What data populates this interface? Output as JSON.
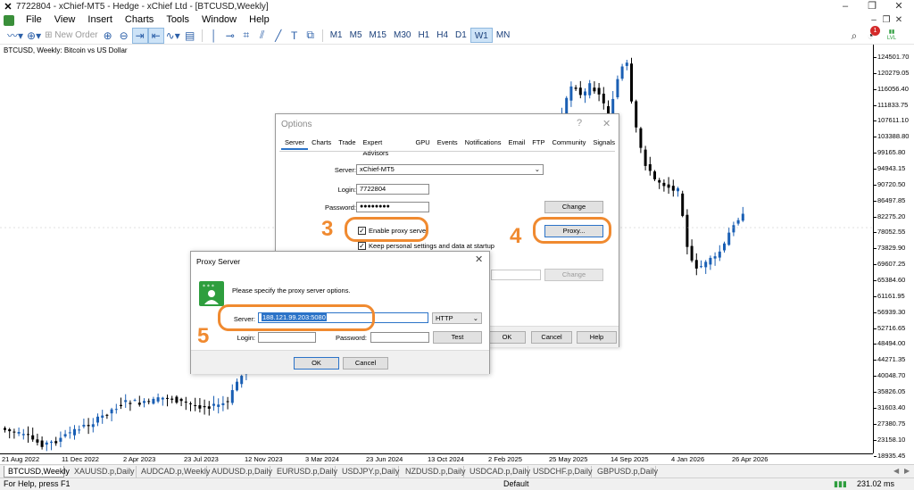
{
  "window": {
    "title": "7722804 - xChief-MT5 - Hedge - xChief Ltd - [BTCUSD,Weekly]",
    "controls": [
      "–",
      "❐",
      "✕"
    ]
  },
  "menu": [
    "File",
    "View",
    "Insert",
    "Charts",
    "Tools",
    "Window",
    "Help"
  ],
  "toolbar": {
    "new_order": "New Order",
    "timeframes": [
      "M1",
      "M5",
      "M15",
      "M30",
      "H1",
      "H4",
      "D1",
      "W1",
      "MN"
    ],
    "active_timeframe": "W1",
    "notification_count": "1",
    "lvl_label": "LVL"
  },
  "chart": {
    "symbol_label": "BTCUSD, Weekly:  Bitcoin vs US Dollar",
    "price_labels": [
      "124501.70",
      "120279.05",
      "116056.40",
      "111833.75",
      "107611.10",
      "103388.80",
      "99165.80",
      "94943.15",
      "90720.50",
      "86497.85",
      "82275.20",
      "78052.55",
      "73829.90",
      "69607.25",
      "65384.60",
      "61161.95",
      "56939.30",
      "52716.65",
      "48494.00",
      "44271.35",
      "40048.70",
      "35826.05",
      "31603.40",
      "27380.75",
      "23158.10",
      "18935.45"
    ],
    "date_labels": [
      "21 Aug 2022",
      "11 Dec 2022",
      "2 Apr 2023",
      "23 Jul 2023",
      "12 Nov 2023",
      "3 Mar 2024",
      "23 Jun 2024",
      "13 Oct 2024",
      "2 Feb 2025",
      "25 May 2025",
      "14 Sep 2025",
      "4 Jan 2026",
      "26 Apr 2026"
    ],
    "colors": {
      "up": "#1a5fb4",
      "down": "#000000"
    }
  },
  "tabs": {
    "items": [
      "BTCUSD,Weekly",
      "XAUUSD.p,Daily",
      "AUDCAD.p,Weekly",
      "AUDUSD.p,Daily",
      "EURUSD.p,Daily",
      "USDJPY.p,Daily",
      "NZDUSD.p,Daily",
      "USDCAD.p,Daily",
      "USDCHF.p,Daily",
      "GBPUSD.p,Daily"
    ],
    "active": "BTCUSD,Weekly"
  },
  "status": {
    "help": "For Help, press F1",
    "profile": "Default",
    "ping": "231.02 ms"
  },
  "options_dialog": {
    "title": "Options",
    "help_btn": "?",
    "close_btn": "✕",
    "tabs": [
      "Server",
      "Charts",
      "Trade",
      "Expert Advisors",
      "GPU",
      "Events",
      "Notifications",
      "Email",
      "FTP",
      "Community",
      "Signals"
    ],
    "active_tab": "Server",
    "server_label": "Server:",
    "server_value": "xChief-MT5",
    "login_label": "Login:",
    "login_value": "7722804",
    "password_label": "Password:",
    "password_value": "●●●●●●●●",
    "change_button": "Change",
    "enable_proxy_label": "Enable proxy server",
    "proxy_button": "Proxy...",
    "keep_personal_label": "Keep personal settings and data at startup",
    "change_button_2": "Change",
    "ok_button": "OK",
    "cancel_button": "Cancel",
    "help_button": "Help"
  },
  "proxy_dialog": {
    "title": "Proxy Server",
    "close_btn": "✕",
    "message": "Please specify the proxy server options.",
    "server_label": "Server:",
    "server_value": "188.121.99.203:5080",
    "type_value": "HTTP",
    "login_label": "Login:",
    "login_value": "",
    "password_label": "Password:",
    "password_value": "",
    "test_button": "Test",
    "ok_button": "OK",
    "cancel_button": "Cancel"
  },
  "annotations": {
    "step3": "3",
    "step4": "4",
    "step5": "5",
    "color": "#f08a30"
  }
}
